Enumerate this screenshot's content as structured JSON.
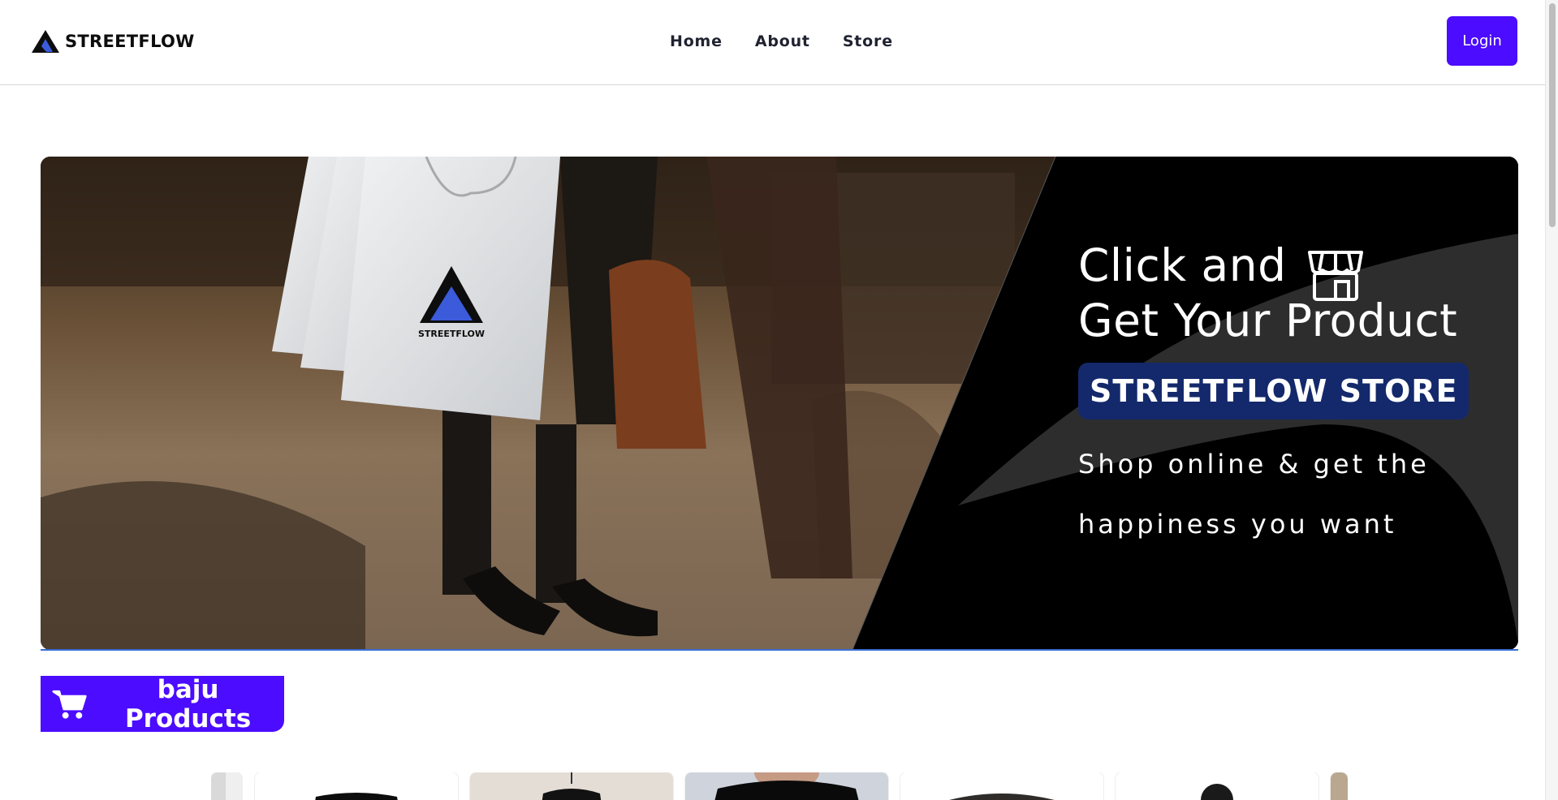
{
  "brand": {
    "name": "STREETFLOW"
  },
  "nav": {
    "items": [
      "Home",
      "About",
      "Store"
    ]
  },
  "login_label": "Login",
  "hero": {
    "line1": "Click and",
    "line2": "Get Your Product",
    "badge": "STREETFLOW STORE",
    "subtitle_line1": "Shop online & get the",
    "subtitle_line2": "happiness you want",
    "bag_logo_text": "STREETFLOW"
  },
  "section": {
    "label": "baju Products",
    "icon": "cart-icon"
  },
  "colors": {
    "accent": "#4b0cff",
    "badge": "#14296b",
    "hero_dark": "#000000"
  },
  "products": {
    "cards": [
      {
        "name": "product-card-1",
        "img": "black-tshirt"
      },
      {
        "name": "product-card-2",
        "img": "hanging-shirt"
      },
      {
        "name": "product-card-3",
        "img": "model-black-tshirt"
      },
      {
        "name": "product-card-4",
        "img": "dark-tshirt"
      },
      {
        "name": "product-card-5",
        "img": "person"
      }
    ]
  }
}
